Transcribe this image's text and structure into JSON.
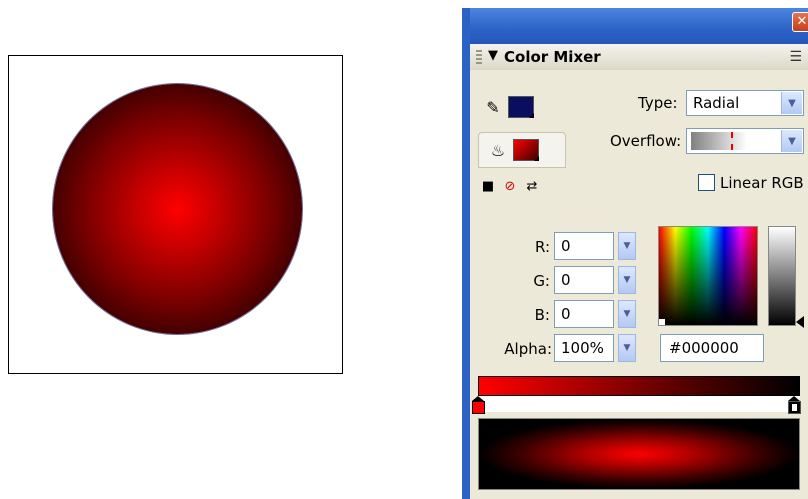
{
  "panel": {
    "title": "Color Mixer",
    "close_glyph": "✕",
    "stroke_color": "#0b0e60",
    "fill_color_start": "#ff0000",
    "fill_color_end": "#000000",
    "type_label": "Type:",
    "type_value": "Radial",
    "overflow_label": "Overflow:",
    "linear_rgb_label": "Linear RGB",
    "linear_rgb_checked": false
  },
  "rgb": {
    "r_label": "R:",
    "r_value": "0",
    "g_label": "G:",
    "g_value": "0",
    "b_label": "B:",
    "b_value": "0",
    "alpha_label": "Alpha:",
    "alpha_value": "100%"
  },
  "hex": {
    "value": "#000000"
  },
  "gradient": {
    "type": "radial",
    "stops": [
      {
        "color": "#ff0000",
        "position_pct": 0
      },
      {
        "color": "#000000",
        "position_pct": 100
      }
    ]
  },
  "icons": {
    "title_arrow": "▼",
    "options": "☰",
    "pencil": "✎",
    "bucket": "♨",
    "black_white": "■",
    "no_color": "⊘",
    "swap": "⇄",
    "dropdown": "▼"
  }
}
